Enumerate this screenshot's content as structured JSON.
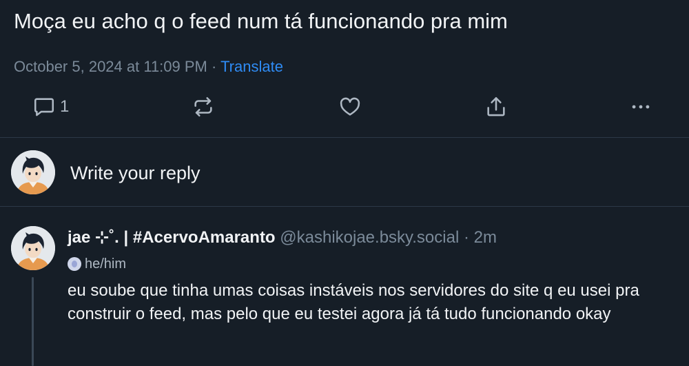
{
  "post": {
    "text": "Moça eu acho q o feed num tá funcionando pra mim",
    "timestamp": "October 5, 2024 at 11:09 PM",
    "separator": "·",
    "translate_label": "Translate"
  },
  "actions": {
    "reply_count": "1",
    "icons": [
      "reply-icon",
      "repost-icon",
      "like-icon",
      "share-icon",
      "more-icon"
    ]
  },
  "composer": {
    "placeholder": "Write your reply"
  },
  "reply": {
    "display_name": "jae ⊹˚. | #AcervoAmaranto",
    "handle": "@kashikojae.bsky.social",
    "separator": "·",
    "time_ago": "2m",
    "pronouns": "he/him",
    "text": "eu soube que tinha umas coisas instáveis nos servidores do site q eu usei pra construir o feed, mas pelo que eu testei agora já tá tudo funcionando okay"
  },
  "colors": {
    "background": "#161e27",
    "text": "#f1f3f5",
    "muted": "#7b8a99",
    "link": "#2f8cf5",
    "divider": "#2c3947"
  }
}
